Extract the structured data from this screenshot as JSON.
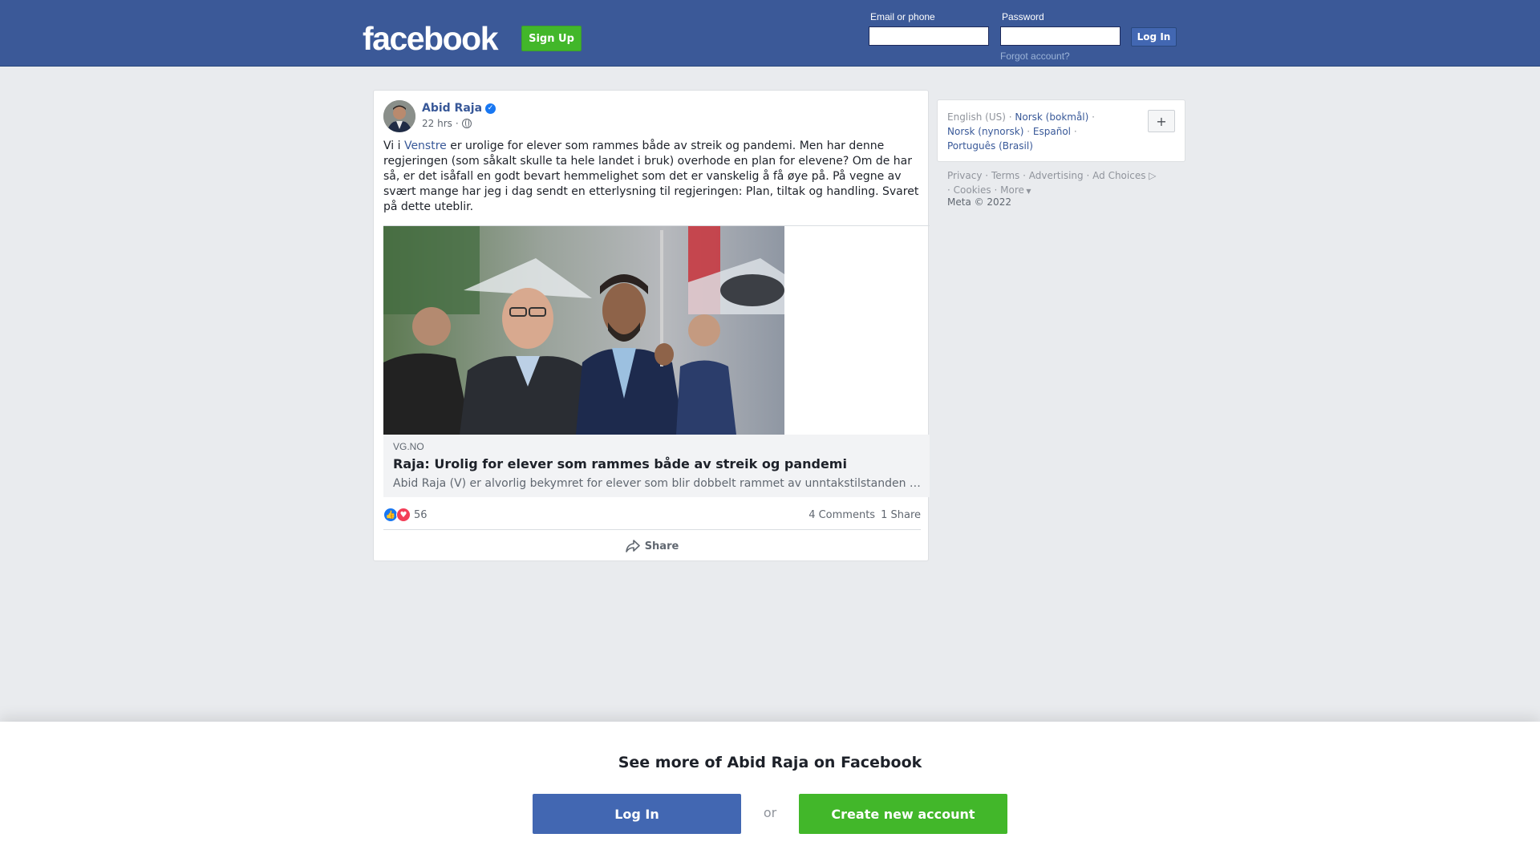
{
  "header": {
    "logo": "facebook",
    "signup_label": "Sign Up",
    "email_label": "Email or phone",
    "password_label": "Password",
    "email_value": "",
    "password_value": "",
    "login_label": "Log In",
    "forgot_label": "Forgot account?"
  },
  "post": {
    "author": "Abid Raja",
    "time": "22 hrs",
    "dot": "·",
    "text_prefix": "Vi i ",
    "text_link": "Venstre",
    "text_rest": " er urolige for elever som rammes både av streik og pandemi. Men har denne regjeringen (som såkalt skulle ta hele landet i bruk) overhode en plan for elevene? Om de har så, er det isåfall en godt bevart hemmelighet som det er vanskelig å få øye på. På vegne av svært mange har jeg i dag sendt en etterlysning til regjeringen: Plan, tiltak og handling. Svaret på dette uteblir.",
    "link": {
      "domain": "VG.NO",
      "title": "Raja: Urolig for elever som rammes både av streik og pandemi",
      "description": "Abid Raja (V) er alvorlig bekymret for elever som blir dobbelt rammet av unntakstilstanden i skolen – både på grunn av streik og pandemi."
    },
    "reactions_count": "56",
    "comments": "4 Comments",
    "shares": "1 Share",
    "share_label": "Share"
  },
  "sidebar": {
    "languages": [
      "English (US)",
      "Norsk (bokmål)",
      "Norsk (nynorsk)",
      "Español",
      "Português (Brasil)"
    ],
    "sep": "·",
    "plus_label": "+",
    "footer_links": [
      "Privacy",
      "Terms",
      "Advertising",
      "Ad Choices",
      "Cookies",
      "More"
    ],
    "copyright": "Meta © 2022"
  },
  "banner": {
    "title": "See more of Abid Raja on Facebook",
    "login_label": "Log In",
    "or_label": "or",
    "create_label": "Create new account"
  },
  "colors": {
    "brand_blue": "#3b5998",
    "signup_green": "#42b72a",
    "link_blue": "#385898"
  }
}
